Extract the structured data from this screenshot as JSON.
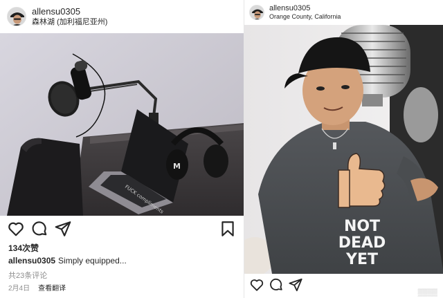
{
  "left_post": {
    "username": "allensu0305",
    "location": "森林湖 (加利福尼亚州)",
    "likes": "134次赞",
    "caption_user": "allensu0305",
    "caption_text": "Simply equipped...",
    "comments": "共23条评论",
    "date": "2月4日",
    "translate": "查看翻译",
    "laptop_sticker": "FUCK compliments",
    "headphone_brand": "M"
  },
  "right_post": {
    "username": "allensu0305",
    "location": "Orange County, California",
    "shirt_text": [
      "NOT",
      "DEAD",
      "YET"
    ]
  },
  "icons": {
    "like": "heart-icon",
    "comment": "comment-icon",
    "share": "paper-plane-icon",
    "save": "bookmark-icon"
  },
  "colors": {
    "text": "#262626",
    "muted": "#8e8e8e",
    "divider": "#e6e6e6"
  }
}
